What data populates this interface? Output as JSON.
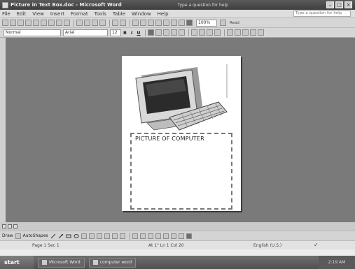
{
  "window": {
    "title": "Picture in Text Box.doc - Microsoft Word",
    "help_placeholder": "Type a question for help"
  },
  "menubar": {
    "items": [
      "File",
      "Edit",
      "View",
      "Insert",
      "Format",
      "Tools",
      "Table",
      "Window",
      "Help"
    ],
    "ask_placeholder": "Type a question for help"
  },
  "toolbar": {
    "zoom": "100%",
    "style": "Normal",
    "font": "Arial",
    "font_size": "12",
    "bold": "B",
    "italic": "I",
    "underline": "U",
    "read_label": "Read"
  },
  "document": {
    "textbox_text": "PICTURE OF COMPUTER"
  },
  "drawbar": {
    "draw_label": "Draw",
    "autoshapes_label": "AutoShapes"
  },
  "status": {
    "page": "Page 1  Sec 1",
    "pos": "At 1\"  Ln 1  Col 20",
    "lang": "English (U.S.)"
  },
  "taskbar": {
    "start": "start",
    "task": "Microsoft Word",
    "task2": "computer word",
    "clock": "2:19 AM"
  }
}
